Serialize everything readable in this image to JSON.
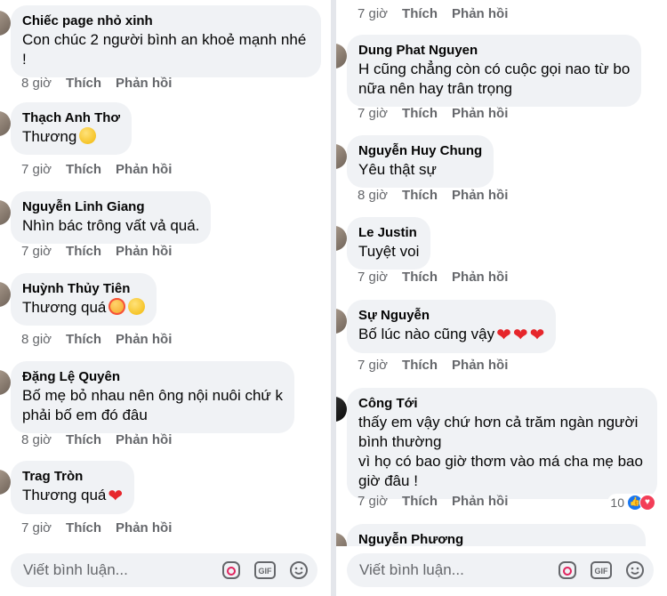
{
  "left": {
    "comments": [
      {
        "name": "Chiếc page nhỏ xinh",
        "text": "Con chúc 2 người bình an khoẻ mạnh nhé\n!",
        "time": "8 giờ",
        "like": "Thích",
        "reply": "Phản hồi"
      },
      {
        "name": "Thạch Anh Thơ",
        "text": "Thương",
        "time": "7 giờ",
        "like": "Thích",
        "reply": "Phản hồi",
        "emoji": "yellow-heart"
      },
      {
        "name": "Nguyễn Linh Giang",
        "text": "Nhìn bác trông vất vả quá.",
        "time": "7 giờ",
        "like": "Thích",
        "reply": "Phản hồi"
      },
      {
        "name": "Huỳnh Thủy Tiên",
        "text": "Thương quá",
        "time": "8 giờ",
        "like": "Thích",
        "reply": "Phản hồi",
        "emoji": "smiling-face-with-hearts, pleading-face"
      },
      {
        "name": "Đặng Lệ Quyên",
        "text": "Bố mẹ bỏ nhau nên ông nội nuôi chứ k\nphải bố em đó đâu",
        "time": "8 giờ",
        "like": "Thích",
        "reply": "Phản hồi"
      },
      {
        "name": "Trag Tròn",
        "text": "Thương quá",
        "time": "7 giờ",
        "like": "Thích",
        "reply": "Phản hồi",
        "emoji": "red-heart"
      }
    ],
    "input_placeholder": "Viết bình luận..."
  },
  "right": {
    "top_actions": {
      "time": "7 giờ",
      "like": "Thích",
      "reply": "Phản hồi"
    },
    "comments": [
      {
        "name": "Dung Phat Nguyen",
        "text": "H cũng chẳng còn có cuộc gọi nao từ bo\nnữa nên hay trân trọng",
        "time": "7 giờ",
        "like": "Thích",
        "reply": "Phản hồi"
      },
      {
        "name": "Nguyễn Huy Chung",
        "text": "Yêu thật sự",
        "time": "8 giờ",
        "like": "Thích",
        "reply": "Phản hồi"
      },
      {
        "name": "Le Justin",
        "text": "Tuyệt voi",
        "time": "7 giờ",
        "like": "Thích",
        "reply": "Phản hồi"
      },
      {
        "name": "Sự Nguyễn",
        "text": "Bố lúc nào cũng vậy",
        "time": "7 giờ",
        "like": "Thích",
        "reply": "Phản hồi",
        "emoji": "red-heart x3"
      },
      {
        "name": "Công Tới",
        "text": "thấy em vậy chứ hơn cả trăm ngàn người\nbình thường\nvì họ có bao giờ thơm vào má cha mẹ bao\ngiờ đâu !",
        "time": "7 giờ",
        "like": "Thích",
        "reply": "Phản hồi",
        "reaction_count": "10"
      },
      {
        "name": "Nguyễn Phương",
        "text": ""
      }
    ],
    "input_placeholder": "Viết bình luận..."
  },
  "icons": {
    "sticker": "sticker-icon",
    "gif": "GIF",
    "emoji": "emoji-icon"
  },
  "colors": {
    "bubble": "#f0f2f5",
    "meta": "#65676b",
    "like": "#1877f2",
    "love": "#f33e58",
    "heart": "#e6262b"
  }
}
